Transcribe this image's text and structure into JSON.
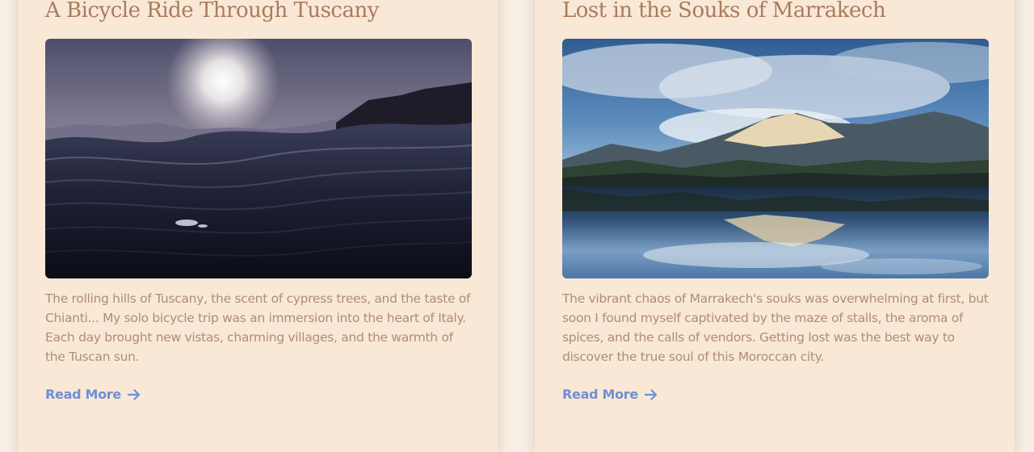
{
  "posts": [
    {
      "title": "A Bicycle Ride Through Tuscany",
      "excerpt": "The rolling hills of Tuscany, the scent of cypress trees, and the taste of Chianti... My solo bicycle trip was an immersion into the heart of Italy. Each day brought new vistas, charming villages, and the warmth of the Tuscan sun.",
      "read_more_label": "Read More",
      "read_more_icon": "arrow-right-icon"
    },
    {
      "title": "Lost in the Souks of Marrakech",
      "excerpt": "The vibrant chaos of Marrakech's souks was overwhelming at first, but soon I found myself captivated by the maze of stalls, the aroma of spices, and the calls of vendors. Getting lost was the best way to discover the true soul of this Moroccan city.",
      "read_more_label": "Read More",
      "read_more_icon": "arrow-right-icon"
    }
  ],
  "colors": {
    "page_background": "#f7eee4",
    "card_background": "#f9e8d6",
    "title": "#a97c5d",
    "body_text": "#b08d74",
    "link": "#6f8fd6"
  }
}
